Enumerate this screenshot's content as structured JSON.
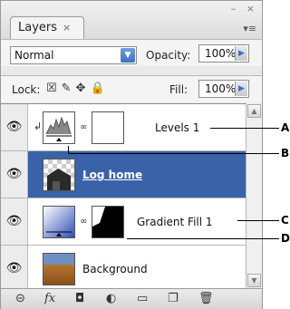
{
  "panel": {
    "tab_label": "Layers",
    "tab_close": "×",
    "window_controls": "– ×",
    "menu_glyph": "▾≡"
  },
  "controls": {
    "blend_mode": "Normal",
    "opacity_label": "Opacity:",
    "opacity_value": "100%",
    "lock_label": "Lock:",
    "fill_label": "Fill:",
    "fill_value": "100%"
  },
  "layers": [
    {
      "name": "Levels 1",
      "selected": false
    },
    {
      "name": "Log home",
      "selected": true
    },
    {
      "name": "Gradient Fill 1",
      "selected": false
    },
    {
      "name": "Background",
      "selected": false
    }
  ],
  "callouts": [
    "A",
    "B",
    "C",
    "D"
  ],
  "icons": {
    "eye": "eye-icon",
    "link": "chain-link-icon",
    "fx": "fx-icon",
    "mask": "add-mask-icon",
    "adjust": "adjustment-layer-icon",
    "folder": "new-group-icon",
    "new": "new-layer-icon",
    "trash": "trash-icon"
  },
  "bottom_bar": {
    "fx_label": "fx"
  }
}
